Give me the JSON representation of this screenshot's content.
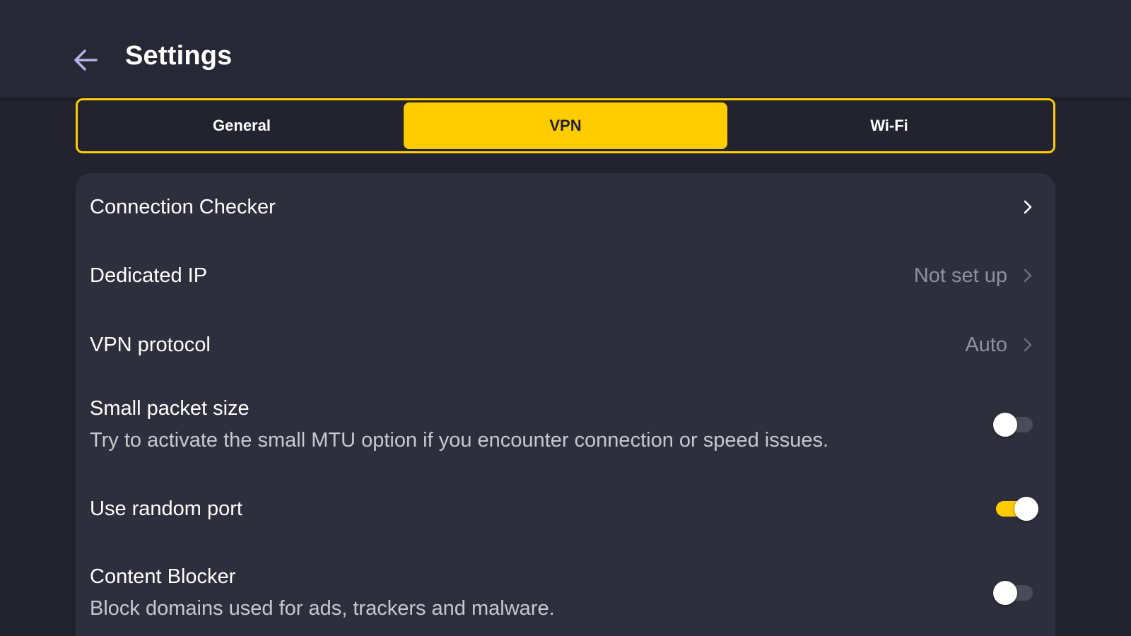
{
  "header": {
    "title": "Settings",
    "back_icon": "arrow-left-icon"
  },
  "tabs": [
    {
      "label": "General",
      "active": false
    },
    {
      "label": "VPN",
      "active": true
    },
    {
      "label": "Wi-Fi",
      "active": false
    }
  ],
  "settings": {
    "connection_checker": {
      "label": "Connection Checker",
      "icon": "chevron-right-icon"
    },
    "dedicated_ip": {
      "label": "Dedicated IP",
      "value": "Not set up",
      "icon": "chevron-right-icon"
    },
    "vpn_protocol": {
      "label": "VPN protocol",
      "value": "Auto",
      "icon": "chevron-right-icon"
    },
    "small_packet_size": {
      "label": "Small packet size",
      "description": "Try to activate the small MTU option if you encounter connection or speed issues.",
      "enabled": false
    },
    "use_random_port": {
      "label": "Use random port",
      "enabled": true
    },
    "content_blocker": {
      "label": "Content Blocker",
      "description": "Block domains used for ads, trackers and malware.",
      "enabled": false
    }
  },
  "colors": {
    "background": "#22232e",
    "header": "#262835",
    "card": "#2d2f3d",
    "accent": "#ffcc00",
    "muted_text": "#8f909b"
  }
}
